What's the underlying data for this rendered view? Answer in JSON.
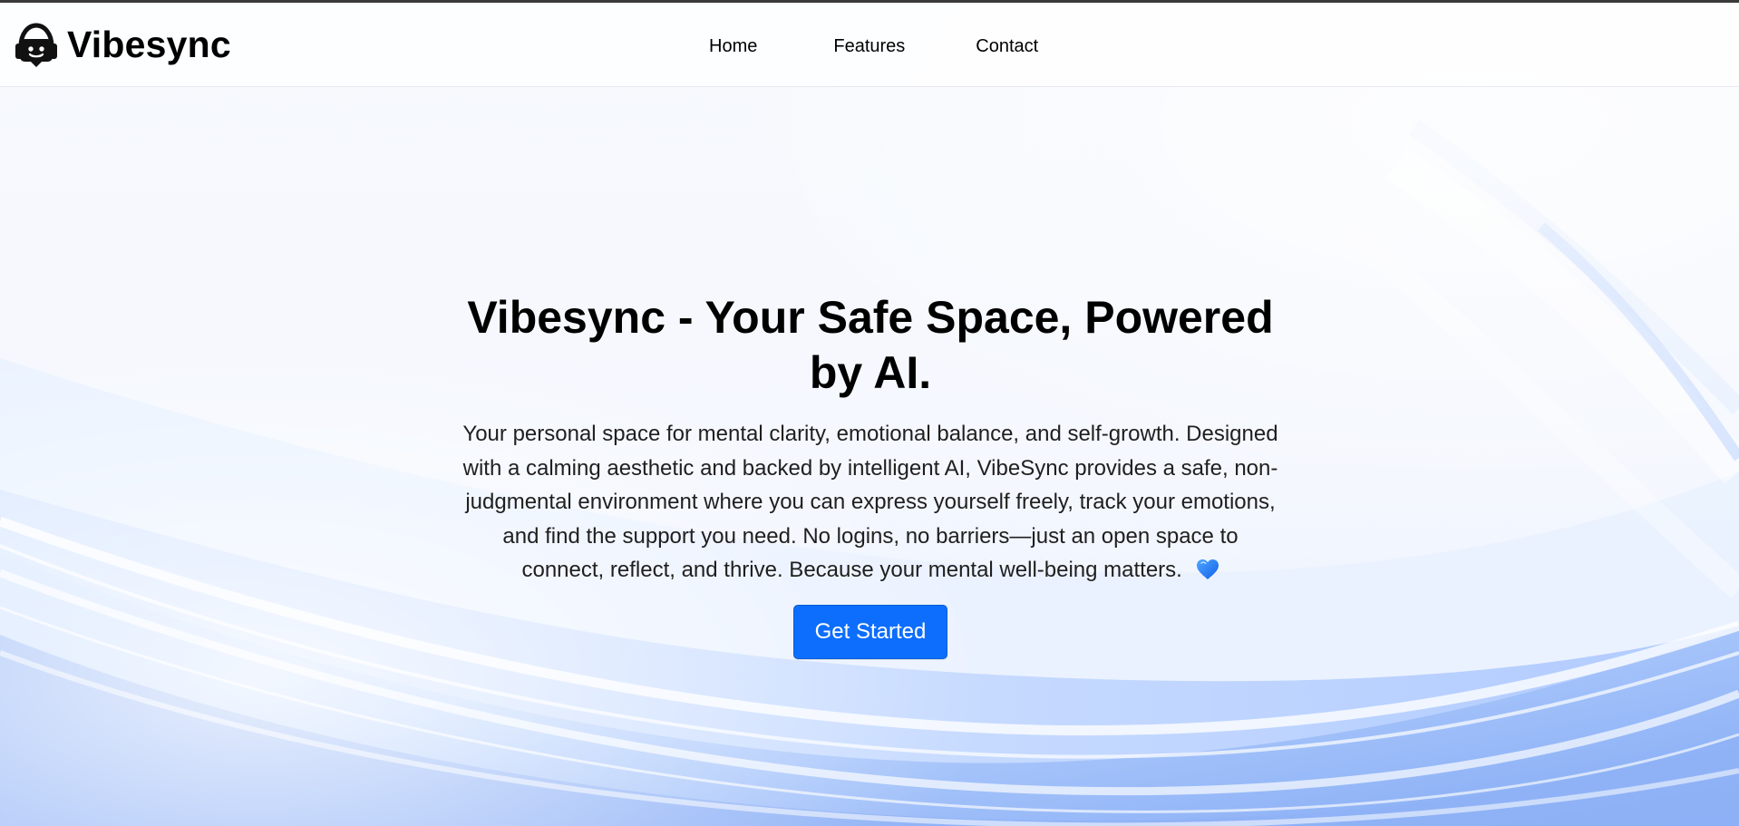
{
  "brand": {
    "name": "Vibesync",
    "icon": "headset-chat-icon"
  },
  "nav": {
    "items": [
      "Home",
      "Features",
      "Contact"
    ]
  },
  "hero": {
    "title": "Vibesync - Your Safe Space, Powered by AI.",
    "description": "Your personal space for mental clarity, emotional balance, and self-growth. Designed with a calming aesthetic and backed by intelligent AI, VibeSync provides a safe, non-judgmental environment where you can express yourself freely, track your emotions, and find the support you need. No logins, no barriers—just an open space to connect, reflect, and thrive. Because your mental well-being matters.",
    "emoji": "blue-heart-icon",
    "cta": "Get Started"
  },
  "colors": {
    "accent": "#0d6efd",
    "background": "#f6f9fe",
    "wave": "#7ea6f3"
  }
}
